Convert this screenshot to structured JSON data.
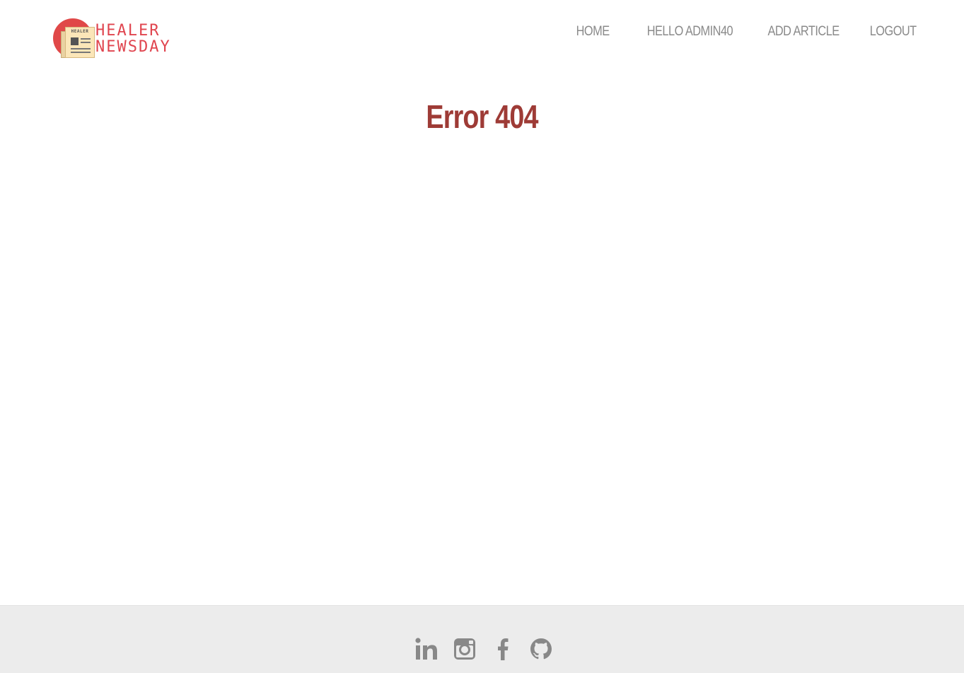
{
  "header": {
    "logo": {
      "word_top": "HEALER",
      "word_bottom": "NEWSDAY",
      "paper_title": "HEALER",
      "brand_color": "#e0454f",
      "circle_color": "#e04848"
    },
    "nav": [
      {
        "label": "HOME"
      },
      {
        "label": "HELLO ADMIN40"
      },
      {
        "label": "ADD ARTICLE"
      },
      {
        "label": "LOGOUT"
      }
    ]
  },
  "main": {
    "title": "Error 404",
    "title_color": "#9e3b36"
  },
  "footer": {
    "background": "#ececec",
    "socials": [
      {
        "icon": "linkedin-icon"
      },
      {
        "icon": "instagram-icon"
      },
      {
        "icon": "facebook-icon"
      },
      {
        "icon": "github-icon"
      }
    ],
    "icon_color": "#888888"
  }
}
